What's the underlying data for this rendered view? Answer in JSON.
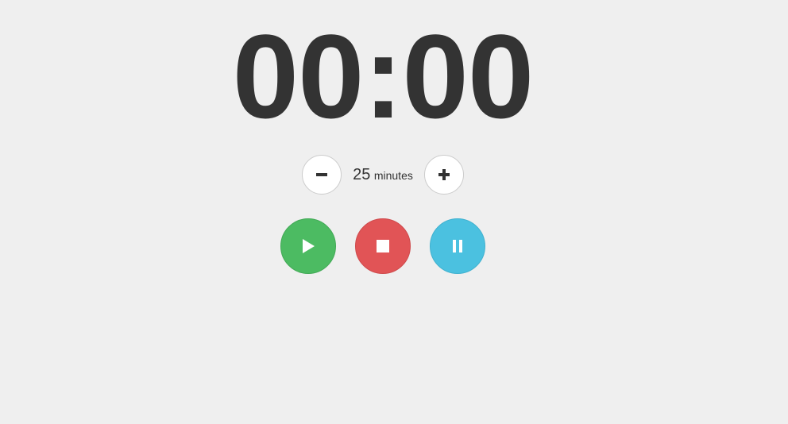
{
  "timer": {
    "display": "00:00"
  },
  "duration": {
    "value": "25",
    "unit": "minutes"
  },
  "icons": {
    "decrease": "minus-icon",
    "increase": "plus-icon",
    "start": "play-icon",
    "stop": "stop-icon",
    "pause": "pause-icon"
  },
  "colors": {
    "background": "#efefef",
    "text": "#333333",
    "start": "#4cbb62",
    "stop": "#e15456",
    "pause": "#4bc1e0"
  }
}
